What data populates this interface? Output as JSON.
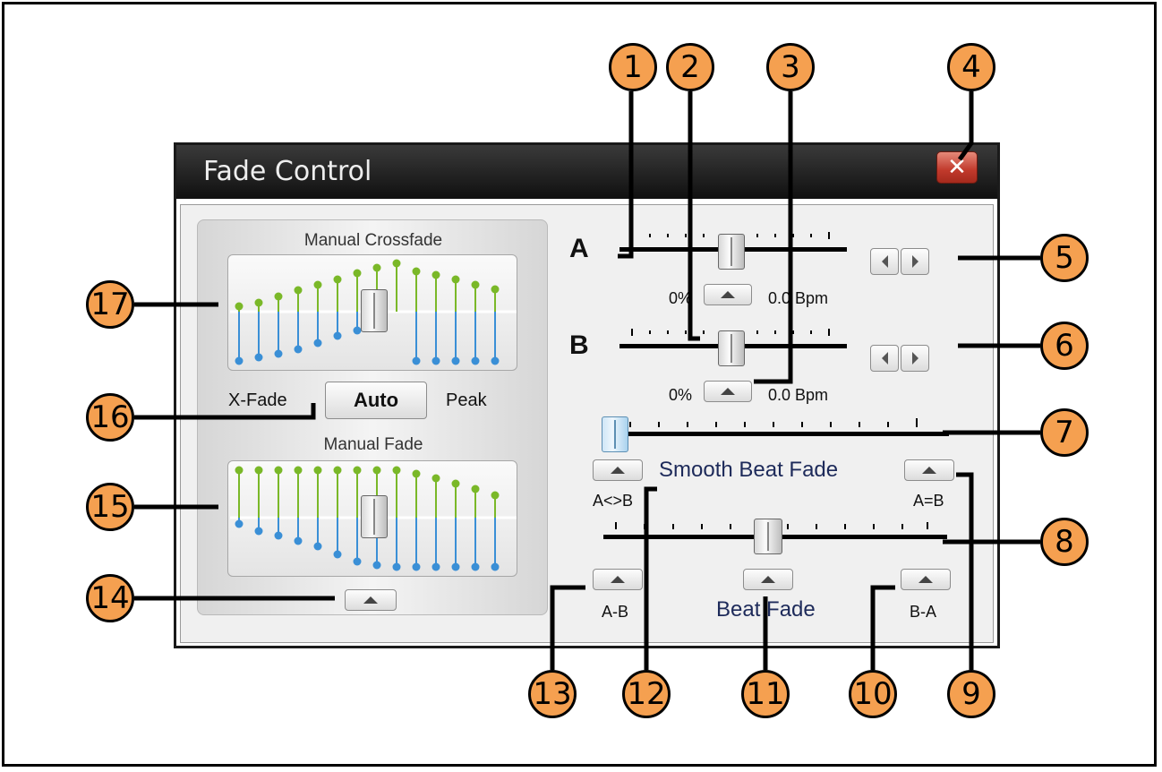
{
  "window": {
    "title": "Fade Control",
    "close_glyph": "✕"
  },
  "left_panel": {
    "manual_crossfade_label": "Manual Crossfade",
    "xfade_label": "X-Fade",
    "auto_button_label": "Auto",
    "peak_label": "Peak",
    "manual_fade_label": "Manual Fade"
  },
  "deck_a": {
    "label": "A",
    "percent": "0%",
    "bpm": "0.0 Bpm"
  },
  "deck_b": {
    "label": "B",
    "percent": "0%",
    "bpm": "0.0 Bpm"
  },
  "smooth_beat_fade": {
    "label": "Smooth Beat Fade",
    "left_button_caption": "A<>B",
    "right_button_caption": "A=B"
  },
  "beat_fade": {
    "label": "Beat Fade",
    "left_button_caption": "A-B",
    "right_button_caption": "B-A"
  },
  "callouts": [
    "1",
    "2",
    "3",
    "4",
    "5",
    "6",
    "7",
    "8",
    "9",
    "10",
    "11",
    "12",
    "13",
    "14",
    "15",
    "16",
    "17"
  ],
  "colors": {
    "callout_fill": "#f5a050",
    "green_stem": "#7ab828",
    "blue_stem": "#3a8fd6",
    "close_red": "#c0392b"
  },
  "icons": {
    "close": "close-icon",
    "arrow_up": "arrow-up-icon",
    "arrow_left": "arrow-left-icon",
    "arrow_right": "arrow-right-icon"
  }
}
